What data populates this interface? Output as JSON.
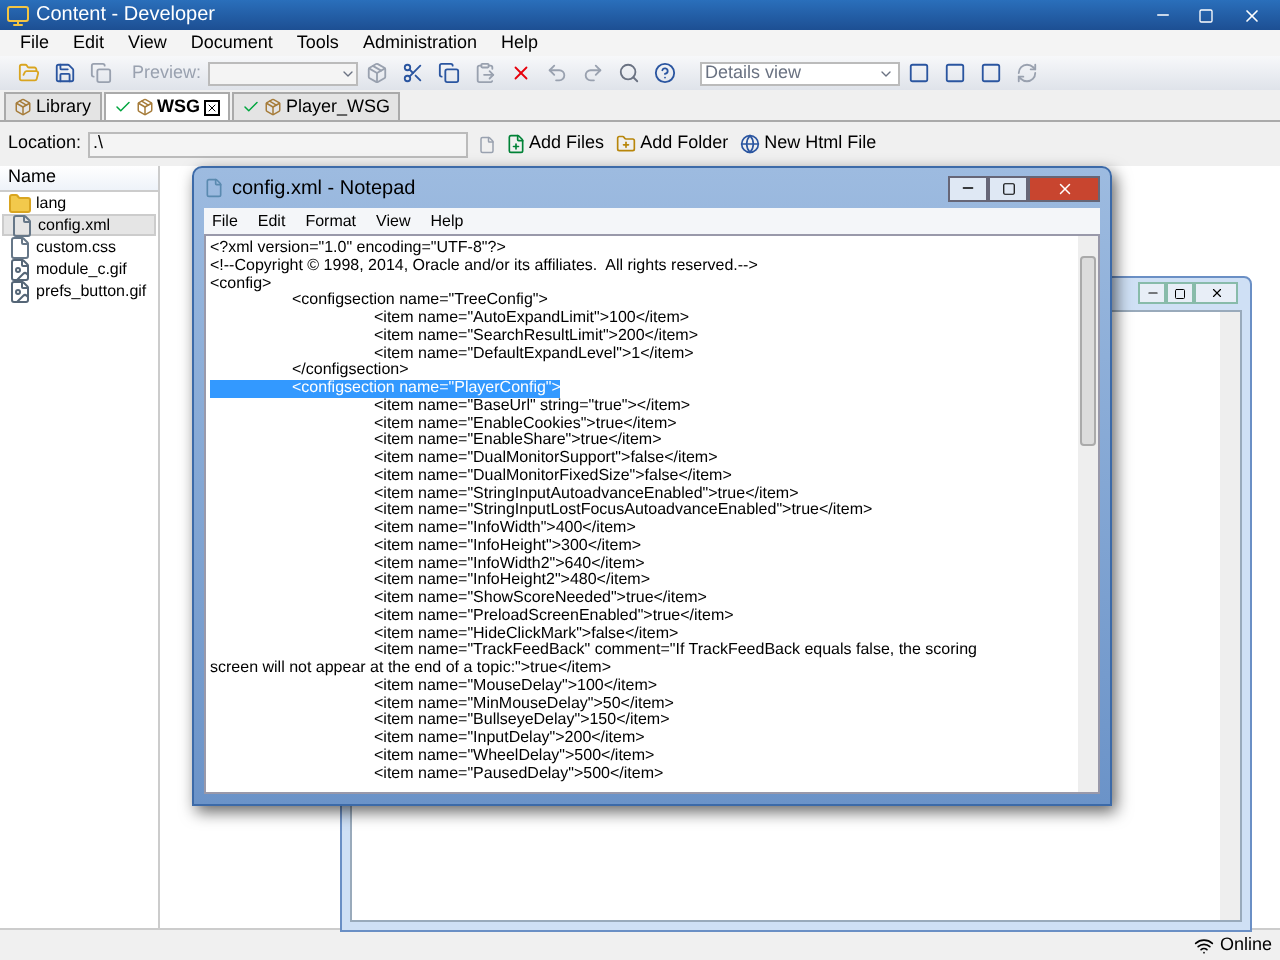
{
  "window": {
    "title": "Content - Developer"
  },
  "menu": [
    "File",
    "Edit",
    "View",
    "Document",
    "Tools",
    "Administration",
    "Help"
  ],
  "toolbar": {
    "preview_label": "Preview:",
    "view_select": "Details view"
  },
  "tabs": [
    {
      "label": "Library",
      "selected": false,
      "checked": false,
      "closable": false
    },
    {
      "label": "WSG",
      "selected": true,
      "checked": true,
      "closable": true
    },
    {
      "label": "Player_WSG",
      "selected": false,
      "checked": true,
      "closable": false
    }
  ],
  "location": {
    "label": "Location:",
    "value": ".\\",
    "actions": [
      "Add Files",
      "Add Folder",
      "New Html File"
    ]
  },
  "file_list": {
    "column": "Name",
    "items": [
      {
        "name": "lang",
        "kind": "folder",
        "selected": false
      },
      {
        "name": "config.xml",
        "kind": "file",
        "selected": true
      },
      {
        "name": "custom.css",
        "kind": "file",
        "selected": false
      },
      {
        "name": "module_c.gif",
        "kind": "image",
        "selected": false
      },
      {
        "name": "prefs_button.gif",
        "kind": "image",
        "selected": false
      }
    ]
  },
  "notepad": {
    "title": "config.xml - Notepad",
    "menu": [
      "File",
      "Edit",
      "Format",
      "View",
      "Help"
    ],
    "lines": [
      {
        "text": "<?xml version=\"1.0\" encoding=\"UTF-8\"?>",
        "selected": false
      },
      {
        "text": "<!--Copyright © 1998, 2014, Oracle and/or its affiliates.  All rights reserved.-->",
        "selected": false
      },
      {
        "text": "<config>",
        "selected": false
      },
      {
        "text": "\t<configsection name=\"TreeConfig\">",
        "selected": false
      },
      {
        "text": "\t\t<item name=\"AutoExpandLimit\">100</item>",
        "selected": false
      },
      {
        "text": "\t\t<item name=\"SearchResultLimit\">200</item>",
        "selected": false
      },
      {
        "text": "\t\t<item name=\"DefaultExpandLevel\">1</item>",
        "selected": false
      },
      {
        "text": "\t</configsection>",
        "selected": false
      },
      {
        "text": "\t<configsection name=\"PlayerConfig\">",
        "selected": true
      },
      {
        "text": "\t\t<item name=\"BaseUrl\" string=\"true\"></item>",
        "selected": false
      },
      {
        "text": "\t\t<item name=\"EnableCookies\">true</item>",
        "selected": false
      },
      {
        "text": "\t\t<item name=\"EnableShare\">true</item>",
        "selected": false
      },
      {
        "text": "\t\t<item name=\"DualMonitorSupport\">false</item>",
        "selected": false
      },
      {
        "text": "\t\t<item name=\"DualMonitorFixedSize\">false</item>",
        "selected": false
      },
      {
        "text": "\t\t<item name=\"StringInputAutoadvanceEnabled\">true</item>",
        "selected": false
      },
      {
        "text": "\t\t<item name=\"StringInputLostFocusAutoadvanceEnabled\">true</item>",
        "selected": false
      },
      {
        "text": "\t\t<item name=\"InfoWidth\">400</item>",
        "selected": false
      },
      {
        "text": "\t\t<item name=\"InfoHeight\">300</item>",
        "selected": false
      },
      {
        "text": "\t\t<item name=\"InfoWidth2\">640</item>",
        "selected": false
      },
      {
        "text": "\t\t<item name=\"InfoHeight2\">480</item>",
        "selected": false
      },
      {
        "text": "\t\t<item name=\"ShowScoreNeeded\">true</item>",
        "selected": false
      },
      {
        "text": "\t\t<item name=\"PreloadScreenEnabled\">true</item>",
        "selected": false
      },
      {
        "text": "\t\t<item name=\"HideClickMark\">false</item>",
        "selected": false
      },
      {
        "text": "\t\t<item name=\"TrackFeedBack\" comment=\"If TrackFeedBack equals false, the scoring",
        "selected": false
      },
      {
        "text": "screen will not appear at the end of a topic:\">true</item>",
        "selected": false
      },
      {
        "text": "\t\t<item name=\"MouseDelay\">100</item>",
        "selected": false
      },
      {
        "text": "\t\t<item name=\"MinMouseDelay\">50</item>",
        "selected": false
      },
      {
        "text": "\t\t<item name=\"BullseyeDelay\">150</item>",
        "selected": false
      },
      {
        "text": "\t\t<item name=\"InputDelay\">200</item>",
        "selected": false
      },
      {
        "text": "\t\t<item name=\"WheelDelay\">500</item>",
        "selected": false
      },
      {
        "text": "\t\t<item name=\"PausedDelay\">500</item>",
        "selected": false
      }
    ]
  },
  "status_bar": {
    "text": "Online"
  }
}
